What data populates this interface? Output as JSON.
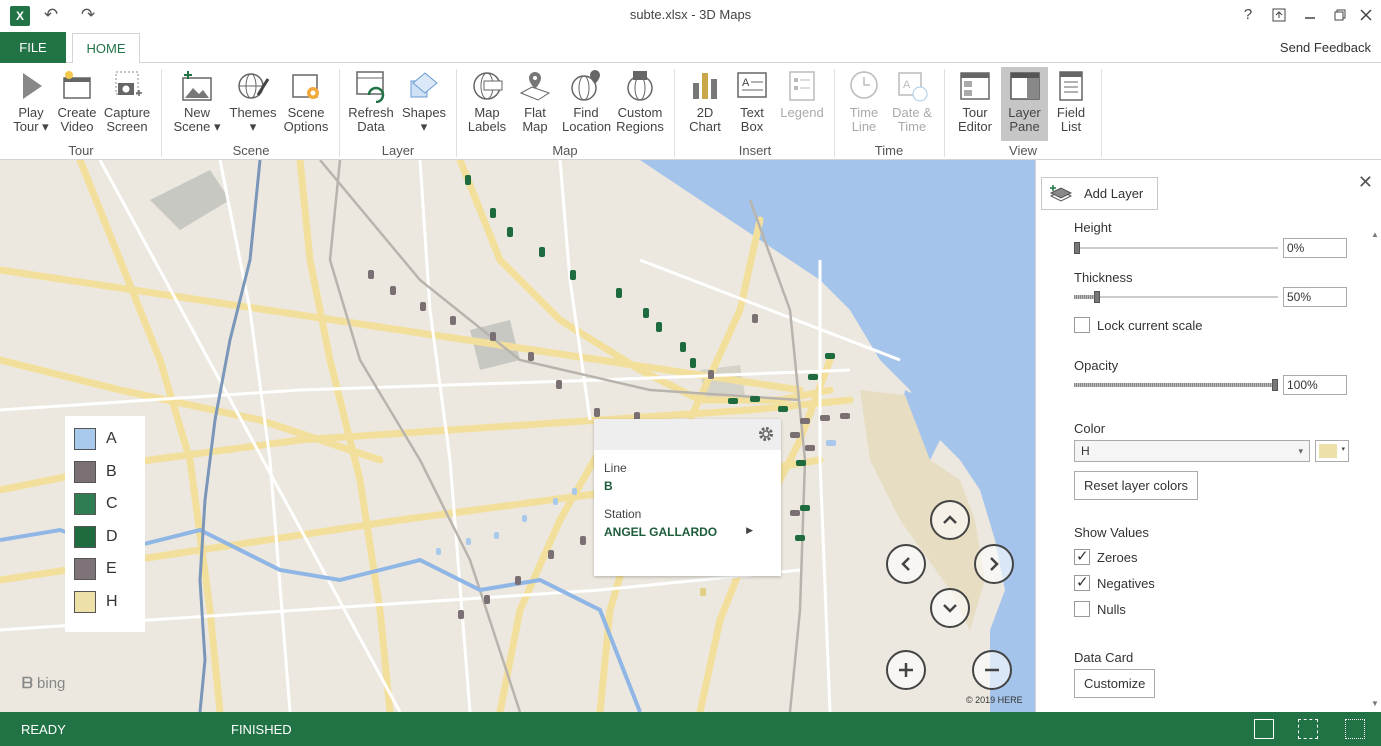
{
  "window": {
    "title": "subte.xlsx - 3D Maps",
    "app_icon": "excel-icon",
    "undo_icon": "undo-icon",
    "redo_icon": "redo-icon",
    "help_label": "?",
    "controls": [
      "help-icon",
      "restore-down-icon",
      "minimize-icon",
      "maximize-icon",
      "close-icon"
    ]
  },
  "tabs": {
    "file": "FILE",
    "home": "HOME",
    "send_feedback": "Send Feedback"
  },
  "ribbon": {
    "groups": {
      "tour": "Tour",
      "scene": "Scene",
      "layer": "Layer",
      "map": "Map",
      "insert": "Insert",
      "time": "Time",
      "view": "View"
    },
    "buttons": {
      "play_tour": "Play\nTour ▾",
      "create_video": "Create\nVideo",
      "capture_screen": "Capture\nScreen",
      "new_scene": "New\nScene ▾",
      "themes": "Themes\n▾",
      "scene_options": "Scene\nOptions",
      "refresh_data": "Refresh\nData",
      "shapes": "Shapes\n▾",
      "map_labels": "Map\nLabels",
      "flat_map": "Flat\nMap",
      "find_location": "Find\nLocation",
      "custom_regions": "Custom\nRegions",
      "chart_2d": "2D\nChart",
      "text_box": "Text\nBox",
      "legend": "Legend",
      "time_line": "Time\nLine",
      "date_time": "Date &\nTime",
      "tour_editor": "Tour\nEditor",
      "layer_pane": "Layer\nPane",
      "field_list": "Field\nList"
    }
  },
  "legend": {
    "items": [
      {
        "label": "A",
        "color": "#a9c9ec"
      },
      {
        "label": "B",
        "color": "#7a7073"
      },
      {
        "label": "C",
        "color": "#2e7d53"
      },
      {
        "label": "D",
        "color": "#1e6b40"
      },
      {
        "label": "E",
        "color": "#7d7378"
      },
      {
        "label": "H",
        "color": "#ede0a8"
      }
    ]
  },
  "map": {
    "bing": "bing",
    "copyright": "© 2019 HERE"
  },
  "datacard": {
    "field1_label": "Line",
    "field1_value": "B",
    "field2_label": "Station",
    "field2_value": "ANGEL GALLARDO"
  },
  "pane": {
    "add_layer": "Add Layer",
    "height_label": "Height",
    "height_value": "0%",
    "height_level": 0.0,
    "thickness_label": "Thickness",
    "thickness_value": "50%",
    "thickness_level": 0.1,
    "lock_scale": "Lock current scale",
    "lock_scale_checked": false,
    "opacity_label": "Opacity",
    "opacity_value": "100%",
    "opacity_level": 1.0,
    "color_label": "Color",
    "color_select": "H",
    "color_swatch": "#ede0a8",
    "reset_colors": "Reset layer colors",
    "show_values": "Show Values",
    "zeroes": "Zeroes",
    "zeroes_checked": true,
    "negatives": "Negatives",
    "negatives_checked": true,
    "nulls": "Nulls",
    "nulls_checked": false,
    "data_card": "Data Card",
    "customize": "Customize"
  },
  "status": {
    "ready": "READY",
    "finished": "FINISHED"
  },
  "colors": {
    "accent": "#217346",
    "water": "#a4c4ec",
    "land": "#ece8df",
    "road": "#f3df9c"
  }
}
